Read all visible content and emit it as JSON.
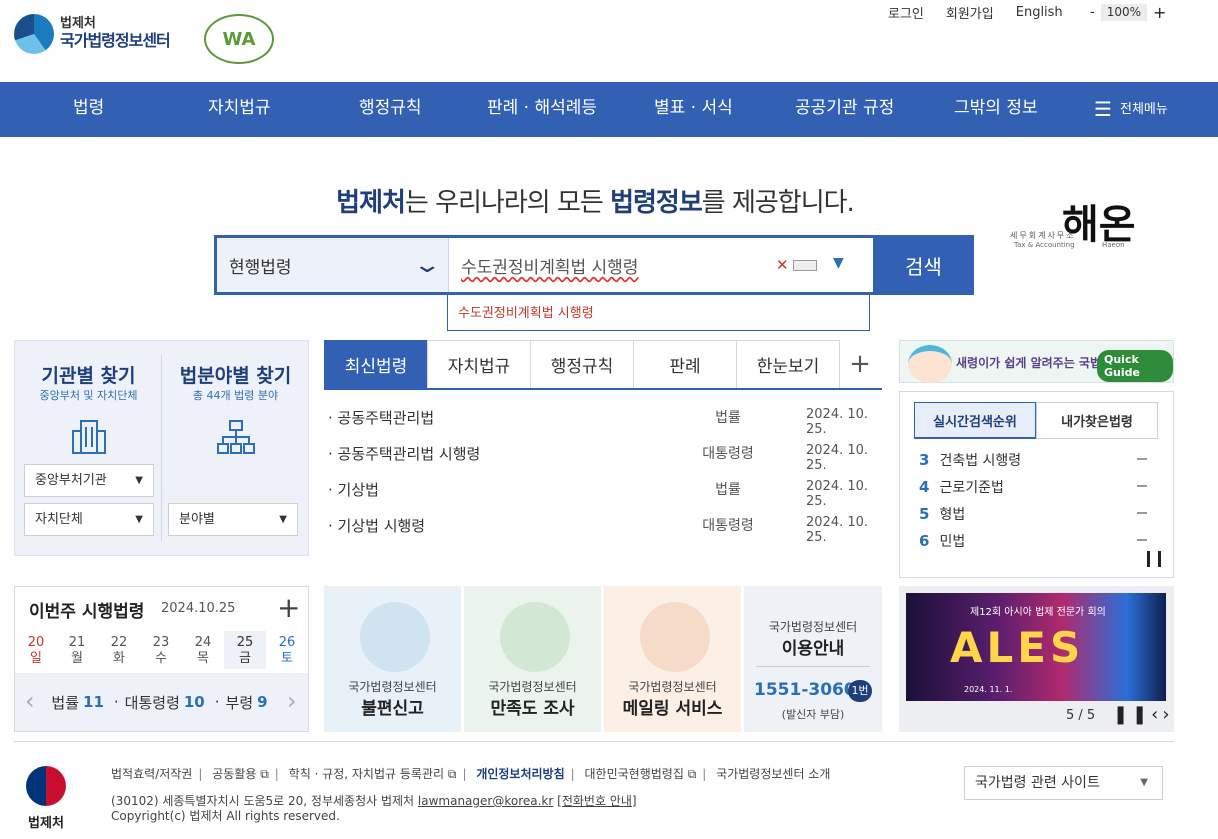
{
  "util": {
    "login": "로그인",
    "join": "회원가입",
    "english": "English",
    "zoom_minus": "-",
    "zoom_value": "100%",
    "zoom_plus": "+"
  },
  "logo": {
    "line1": "법제처",
    "line2": "국가법령정보센터",
    "wa": "WA"
  },
  "nav": [
    "법령",
    "자치법규",
    "행정규칙",
    "판례 · 해석례등",
    "별표 · 서식",
    "공공기관 규정",
    "그밖의 정보"
  ],
  "nav_all": "전체메뉴",
  "hero": {
    "a": "법제처",
    "b": "는 우리나라의 모든 ",
    "c": "법령정보",
    "d": "를 제공합니다."
  },
  "haeon": {
    "big": "해온",
    "sm1": "세무회계사무소",
    "sm2": "Tax & Accounting",
    "sm3": "Haeon"
  },
  "search": {
    "scope": "현행법령",
    "value": "수도권정비계획법 시행령",
    "button": "검색",
    "suggestion": "수도권정비계획법 시행령"
  },
  "left": {
    "org_title": "기관별 찾기",
    "org_sub": "중앙부처 및 자치단체",
    "field_title": "법분야별 찾기",
    "field_sub": "총 44개 법령 분야",
    "dd_central": "중앙부처기관",
    "dd_local": "자치단체",
    "dd_field": "분야별"
  },
  "tabs": [
    "최신법령",
    "자치법규",
    "행정규칙",
    "판례",
    "한눈보기"
  ],
  "laws": [
    {
      "name": "· 공동주택관리법",
      "type": "법률",
      "date": "2024. 10. 25."
    },
    {
      "name": "· 공동주택관리법 시행령",
      "type": "대통령령",
      "date": "2024. 10. 25."
    },
    {
      "name": "· 기상법",
      "type": "법률",
      "date": "2024. 10. 25."
    },
    {
      "name": "· 기상법 시행령",
      "type": "대통령령",
      "date": "2024. 10. 25."
    }
  ],
  "quick": {
    "text": "새령이가 쉽게 알려주는 국법",
    "badge": "Quick Guide"
  },
  "rank": {
    "tab1": "실시간검색순위",
    "tab2": "내가찾은법령",
    "items": [
      {
        "n": "3",
        "t": "건축법 시행령"
      },
      {
        "n": "4",
        "t": "근로기준법"
      },
      {
        "n": "5",
        "t": "형법"
      },
      {
        "n": "6",
        "t": "민법"
      }
    ]
  },
  "week": {
    "title": "이번주 시행법령",
    "date": "2024.10.25",
    "plus": "+",
    "days": [
      {
        "d": "20",
        "w": "일"
      },
      {
        "d": "21",
        "w": "월"
      },
      {
        "d": "22",
        "w": "화"
      },
      {
        "d": "23",
        "w": "수"
      },
      {
        "d": "24",
        "w": "목"
      },
      {
        "d": "25",
        "w": "금"
      },
      {
        "d": "26",
        "w": "토"
      }
    ],
    "law_label": "법률",
    "law_count": "11",
    "pres_label": "대통령령",
    "pres_count": "10",
    "min_label": "부령",
    "min_count": "9"
  },
  "cards": [
    {
      "l1": "국가법령정보센터",
      "l2": "불편신고"
    },
    {
      "l1": "국가법령정보센터",
      "l2": "만족도 조사"
    },
    {
      "l1": "국가법령정보센터",
      "l2": "메일링 서비스"
    }
  ],
  "info": {
    "l1": "국가법령정보센터",
    "l2": "이용안내",
    "phone": "1551-3060",
    "badge": "1번",
    "note": "(발신자 부담)"
  },
  "banner": {
    "sub": "제12회 아시아 법제 전문가 회의",
    "ales": "ALES",
    "date": "2024. 11. 1.",
    "page": "5 / 5"
  },
  "footer": {
    "links": [
      "법적효력/저작권",
      "공동활용",
      "학칙 · 규정, 자치법규 등록관리",
      "개인정보처리방침",
      "대한민국현행법령집",
      "국가법령정보센터 소개"
    ],
    "addr": "(30102) 세종특별자치시 도움5로 20, 정부세종청사 법제처 ",
    "email": "lawmanager@korea.kr",
    "phone_link": "[전화번호 안내]",
    "copy": "Copyright(c) 법제처 All rights reserved.",
    "logo": "법제처",
    "select": "국가법령 관련 사이트"
  }
}
